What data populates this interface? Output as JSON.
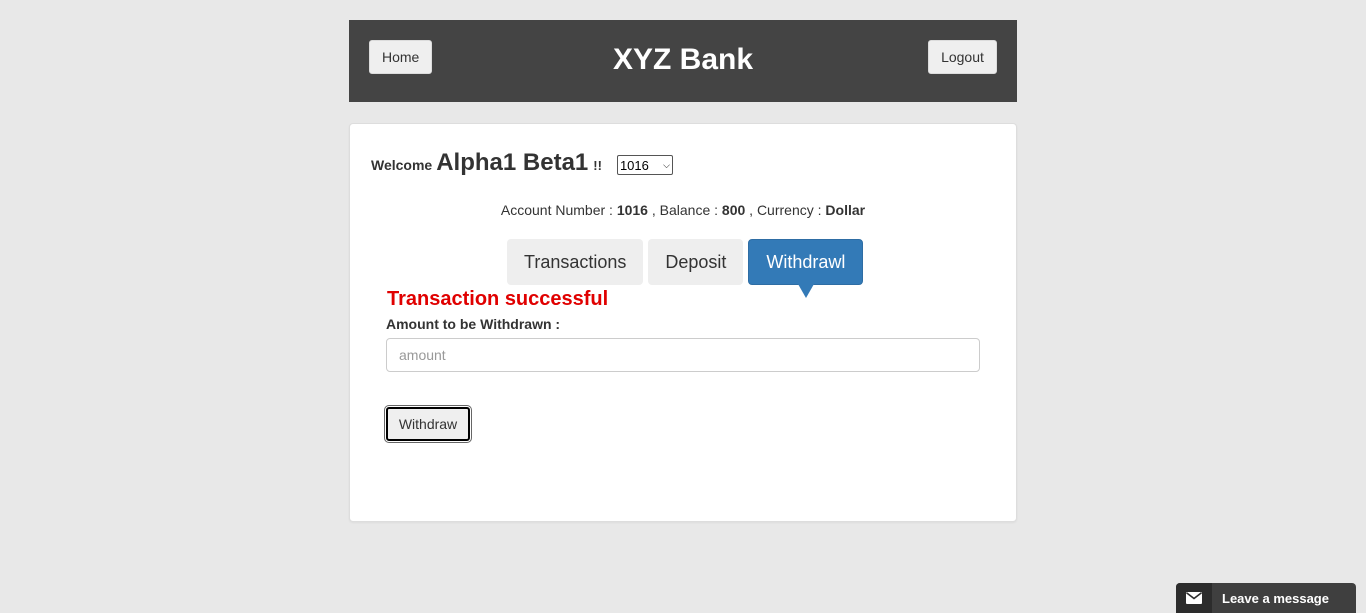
{
  "header": {
    "home_label": "Home",
    "brand": "XYZ Bank",
    "logout_label": "Logout",
    "bg_color": "#444444"
  },
  "welcome": {
    "label": "Welcome",
    "name": "Alpha1 Beta1",
    "suffix": "!!",
    "selected_account": "1016"
  },
  "account_info": {
    "number_label": "Account Number :",
    "number": "1016",
    "balance_label": ", Balance :",
    "balance": "800",
    "currency_label": ", Currency :",
    "currency": "Dollar"
  },
  "tabs": [
    {
      "label": "Transactions",
      "active": false
    },
    {
      "label": "Deposit",
      "active": false
    },
    {
      "label": "Withdrawl",
      "active": true
    }
  ],
  "withdraw_form": {
    "status_message": "Transaction successful",
    "status_color": "#e00000",
    "amount_label": "Amount to be Withdrawn :",
    "amount_value": "",
    "amount_placeholder": "amount",
    "submit_label": "Withdraw"
  },
  "chat_widget": {
    "icon": "envelope-icon",
    "label": "Leave a message"
  },
  "accent_color": "#337ab7"
}
